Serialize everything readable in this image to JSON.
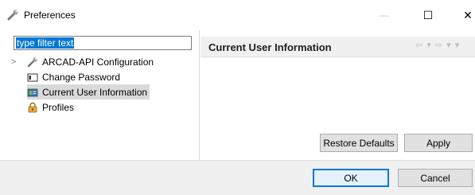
{
  "window": {
    "title": "Preferences",
    "controls": {
      "minimize": "—",
      "maximize": "☐",
      "close": "✕"
    }
  },
  "filter": {
    "text": "type filter text"
  },
  "tree": {
    "items": [
      {
        "label": "ARCAD-API Configuration",
        "icon": "wrench-icon",
        "expandable": true
      },
      {
        "label": "Change Password",
        "icon": "window-icon"
      },
      {
        "label": "Current User Information",
        "icon": "user-card-icon",
        "selected": true
      },
      {
        "label": "Profiles",
        "icon": "lock-icon"
      }
    ]
  },
  "page": {
    "title": "Current User Information",
    "nav": "⇦ ▾ ⇨ ▾ ▾"
  },
  "buttons": {
    "restore_defaults": "Restore Defaults",
    "apply": "Apply",
    "ok": "OK",
    "cancel": "Cancel"
  },
  "colors": {
    "selection": "#0078d7",
    "tree_selected": "#dadada",
    "footer": "#f0f0f0"
  }
}
